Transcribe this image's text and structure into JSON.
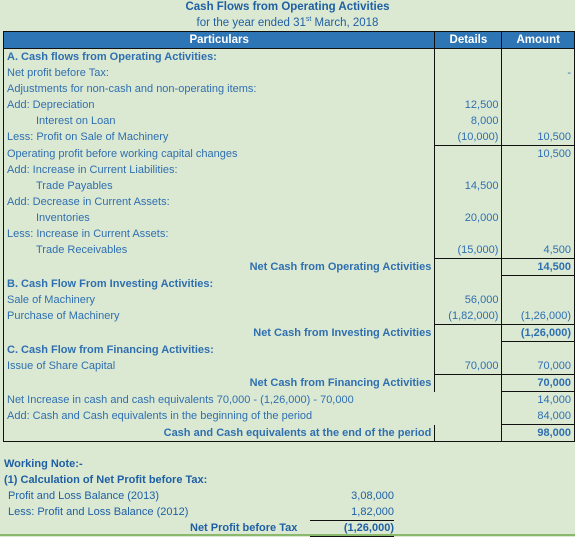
{
  "title": "Cash Flows from Operating Activities",
  "subtitle_prefix": "for the year ended 31",
  "subtitle_sup": "st",
  "subtitle_suffix": " March, 2018",
  "columns": [
    "Particulars",
    "Details",
    "Amount"
  ],
  "rows": [
    {
      "label": "A. Cash flows from Operating Activities:",
      "details": "",
      "amount": ""
    },
    {
      "label": "Net profit before Tax:",
      "details": "",
      "amount": "-"
    },
    {
      "label": "Adjustments for non-cash and non-operating items:",
      "details": "",
      "amount": ""
    },
    {
      "label": "Add: Depreciation",
      "details": "12,500",
      "amount": ""
    },
    {
      "label": "Interest on Loan",
      "details": "8,000",
      "amount": ""
    },
    {
      "label": "Less: Profit on Sale of Machinery",
      "details": "(10,000)",
      "amount": "10,500"
    },
    {
      "label": "Operating profit before working capital changes",
      "details": "",
      "amount": "10,500"
    },
    {
      "label": "Add: Increase in Current Liabilities:",
      "details": "",
      "amount": ""
    },
    {
      "label": "Trade Payables",
      "details": "14,500",
      "amount": ""
    },
    {
      "label": "Add: Decrease in Current Assets:",
      "details": "",
      "amount": ""
    },
    {
      "label": "Inventories",
      "details": "20,000",
      "amount": ""
    },
    {
      "label": "Less: Increase in Current Assets:",
      "details": "",
      "amount": ""
    },
    {
      "label": "Trade Receivables",
      "details": "(15,000)",
      "amount": "4,500"
    },
    {
      "label": "Net Cash from Operating Activities",
      "details": "",
      "amount": "14,500"
    },
    {
      "label": "B. Cash Flow From Investing Activities:",
      "details": "",
      "amount": ""
    },
    {
      "label": "Sale of Machinery",
      "details": "56,000",
      "amount": ""
    },
    {
      "label": "Purchase of Machinery",
      "details": "(1,82,000)",
      "amount": "(1,26,000)"
    },
    {
      "label": "Net Cash from Investing Activities",
      "details": "",
      "amount": "(1,26,000)"
    },
    {
      "label": "C. Cash Flow from Financing Activities:",
      "details": "",
      "amount": ""
    },
    {
      "label": "Issue of Share Capital",
      "details": "70,000",
      "amount": "70,000"
    },
    {
      "label": "Net Cash from Financing Activities",
      "details": "",
      "amount": "70,000"
    },
    {
      "label": "Net Increase in cash and cash equivalents  70,000 - (1,26,000) - 70,000",
      "details": "",
      "amount": "14,000"
    },
    {
      "label": "Add: Cash and Cash equivalents in the beginning of the period",
      "details": "",
      "amount": "84,000"
    },
    {
      "label": "Cash and Cash equivalents at the end of the period",
      "details": "",
      "amount": "98,000"
    }
  ],
  "working_note": {
    "heading": "Working Note:-",
    "subheading": "(1) Calculation of Net Profit before Tax:",
    "lines": [
      {
        "label": "Profit and Loss Balance (2013)",
        "value": "3,08,000"
      },
      {
        "label": "Less: Profit and Loss Balance (2012)",
        "value": "1,82,000"
      }
    ],
    "total_label": "Net Profit before Tax",
    "total_value": "(1,26,000)"
  }
}
